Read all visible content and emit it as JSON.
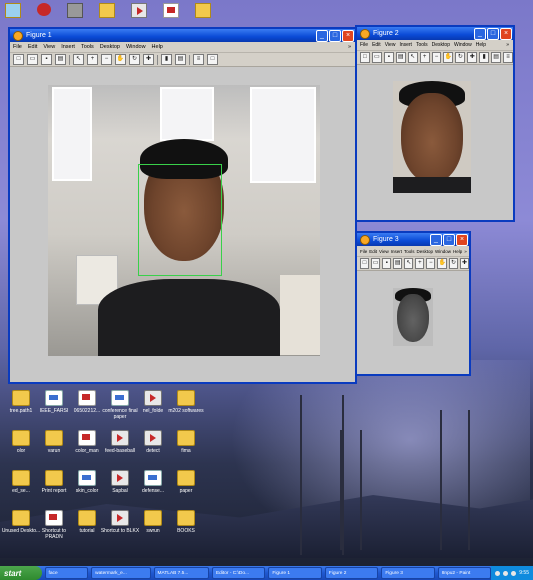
{
  "desktop": {
    "top_icons": [
      "recycle",
      "app-red",
      "dc",
      "folder",
      "doc",
      "pdf",
      "folder"
    ],
    "icons": [
      {
        "label": "tree.path1",
        "type": "folder"
      },
      {
        "label": "IEEE_FARSI",
        "type": "doc"
      },
      {
        "label": "06502212...",
        "type": "pdf"
      },
      {
        "label": "conference final paper",
        "type": "doc"
      },
      {
        "label": "nel_folde",
        "type": "app"
      },
      {
        "label": "m202 softwares",
        "type": "folder"
      },
      {
        "label": "olor",
        "type": "folder"
      },
      {
        "label": "varun",
        "type": "folder"
      },
      {
        "label": "color_man",
        "type": "pdf"
      },
      {
        "label": "feed-baseball",
        "type": "app"
      },
      {
        "label": "detect",
        "type": "app"
      },
      {
        "label": "fima",
        "type": "folder"
      },
      {
        "label": "ed_se...",
        "type": "folder"
      },
      {
        "label": "Print report",
        "type": "folder"
      },
      {
        "label": "skin_color",
        "type": "doc"
      },
      {
        "label": "Sapbal",
        "type": "app"
      },
      {
        "label": "defense...",
        "type": "doc"
      },
      {
        "label": "paper",
        "type": "folder"
      },
      {
        "label": "Unused Deskto...",
        "type": "folder"
      },
      {
        "label": "Shortcut to PRADN",
        "type": "pdf"
      },
      {
        "label": "tutorial",
        "type": "folder"
      },
      {
        "label": "Shortcut to BLKX",
        "type": "app"
      },
      {
        "label": "swrun",
        "type": "folder"
      },
      {
        "label": "BOOKS",
        "type": "folder"
      }
    ]
  },
  "windows": {
    "figure1": {
      "title": "Figure 1",
      "menu": [
        "File",
        "Edit",
        "View",
        "Insert",
        "Tools",
        "Desktop",
        "Window",
        "Help"
      ],
      "tools": [
        "new",
        "open",
        "save",
        "print",
        "pointer",
        "zoom-in",
        "zoom-out",
        "pan",
        "rotate",
        "data-cursor",
        "brush",
        "colorbar",
        "legend",
        "grid",
        "plot"
      ]
    },
    "figure2": {
      "title": "Figure 2",
      "menu": [
        "File",
        "Edit",
        "View",
        "Insert",
        "Tools",
        "Desktop",
        "Window",
        "Help"
      ]
    },
    "figure3": {
      "title": "Figure 3",
      "menu": [
        "File",
        "Edit",
        "View",
        "Insert",
        "Tools",
        "Desktop",
        "Window",
        "Help"
      ]
    }
  },
  "taskbar": {
    "start": "start",
    "tasks": [
      "face",
      "watermark_e...",
      "MATLAB 7.5...",
      "Editor - C:\\Do...",
      "Figure 1",
      "Figure 2",
      "Figure 3",
      "8npu2 - Paint"
    ],
    "clock": "9:55"
  }
}
